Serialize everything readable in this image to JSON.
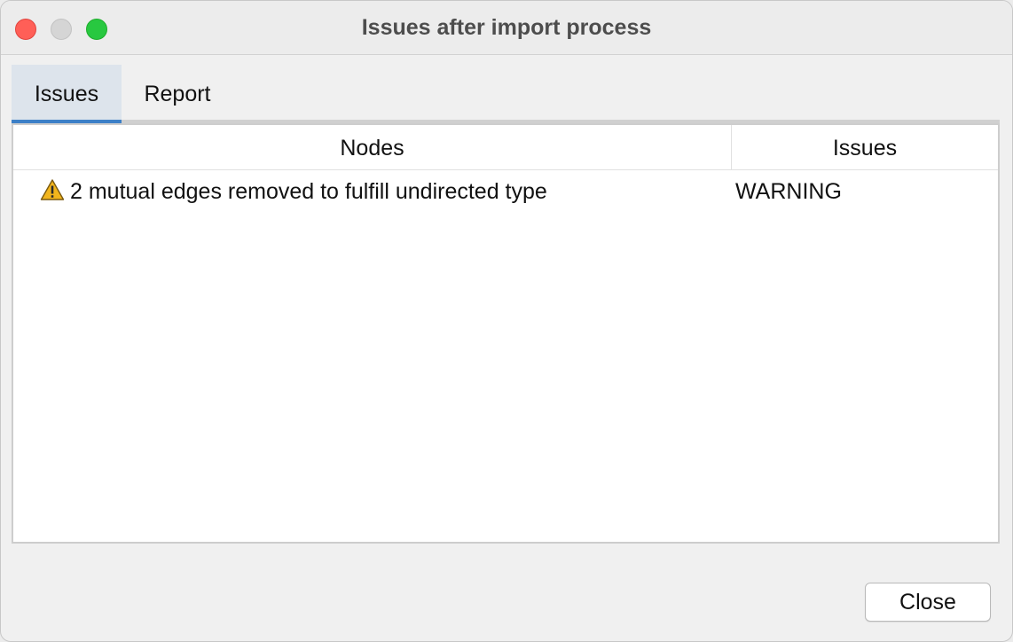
{
  "window": {
    "title": "Issues after import process",
    "controls": [
      "close",
      "minimize",
      "zoom"
    ]
  },
  "tabs": [
    {
      "label": "Issues",
      "active": true
    },
    {
      "label": "Report",
      "active": false
    }
  ],
  "table": {
    "columns": [
      "Nodes",
      "Issues"
    ],
    "rows": [
      {
        "icon": "warning-icon",
        "node": "2 mutual edges removed to fulfill undirected type",
        "issue": "WARNING"
      }
    ]
  },
  "footer": {
    "close_label": "Close"
  },
  "colors": {
    "accent": "#3d80c7",
    "active_tab_bg": "#dde4ec",
    "warning": "#f2b51c"
  }
}
